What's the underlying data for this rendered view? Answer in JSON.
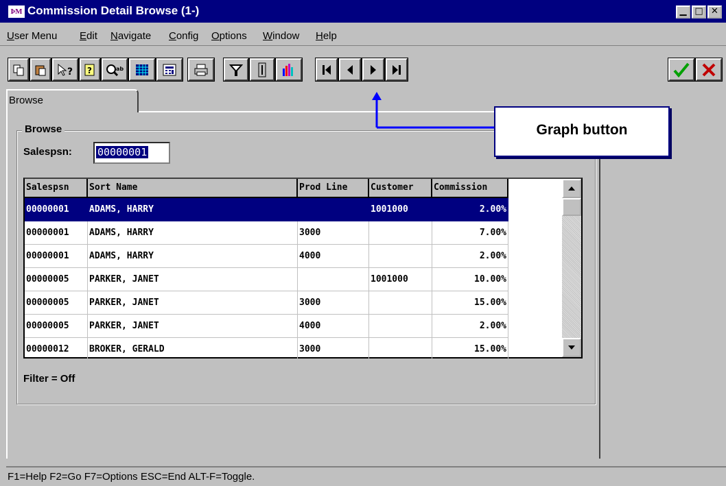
{
  "window": {
    "app_icon_text": "ÞM",
    "title": "Commission Detail Browse (1-)",
    "minimize": "▁",
    "maximize": "□",
    "close": "✕"
  },
  "menu": {
    "items": [
      "User Menu",
      "Edit",
      "Navigate",
      "Config",
      "Options",
      "Window",
      "Help"
    ]
  },
  "toolbar": {
    "buttons": [
      "copy-icon",
      "paste-icon",
      "help-pointer-icon",
      "help-book-icon",
      "zoom-icon",
      "calendar-grid-icon",
      "calculator-icon",
      "print-icon",
      "filter-icon",
      "text-cursor-icon",
      "graph-icon",
      "first-record-icon",
      "previous-record-icon",
      "next-record-icon",
      "last-record-icon",
      "ok-check-icon",
      "cancel-x-icon"
    ],
    "ok_color": "#00a000",
    "cancel_color": "#c00000"
  },
  "tab": {
    "label": "Browse"
  },
  "browse": {
    "group_label": "Browse",
    "salesperson_label": "Salespsn:",
    "salesperson_value": "00000001",
    "filter_text": "Filter = Off"
  },
  "grid": {
    "columns": [
      "Salespsn",
      "Sort Name",
      "Prod Line",
      "Customer",
      "Commission"
    ],
    "rows": [
      [
        "00000001",
        "ADAMS, HARRY",
        "",
        "1001000",
        "2.00%"
      ],
      [
        "00000001",
        "ADAMS, HARRY",
        "3000",
        "",
        "7.00%"
      ],
      [
        "00000001",
        "ADAMS, HARRY",
        "4000",
        "",
        "2.00%"
      ],
      [
        "00000005",
        "PARKER, JANET",
        "",
        "1001000",
        "10.00%"
      ],
      [
        "00000005",
        "PARKER, JANET",
        "3000",
        "",
        "15.00%"
      ],
      [
        "00000005",
        "PARKER, JANET",
        "4000",
        "",
        "2.00%"
      ],
      [
        "00000012",
        "BROKER, GERALD",
        "3000",
        "",
        "15.00%"
      ]
    ],
    "selected_row": 0
  },
  "callout": {
    "label": "Graph button",
    "color": "#0000ff"
  },
  "status": {
    "text": "F1=Help F2=Go F7=Options ESC=End ALT-F=Toggle."
  }
}
